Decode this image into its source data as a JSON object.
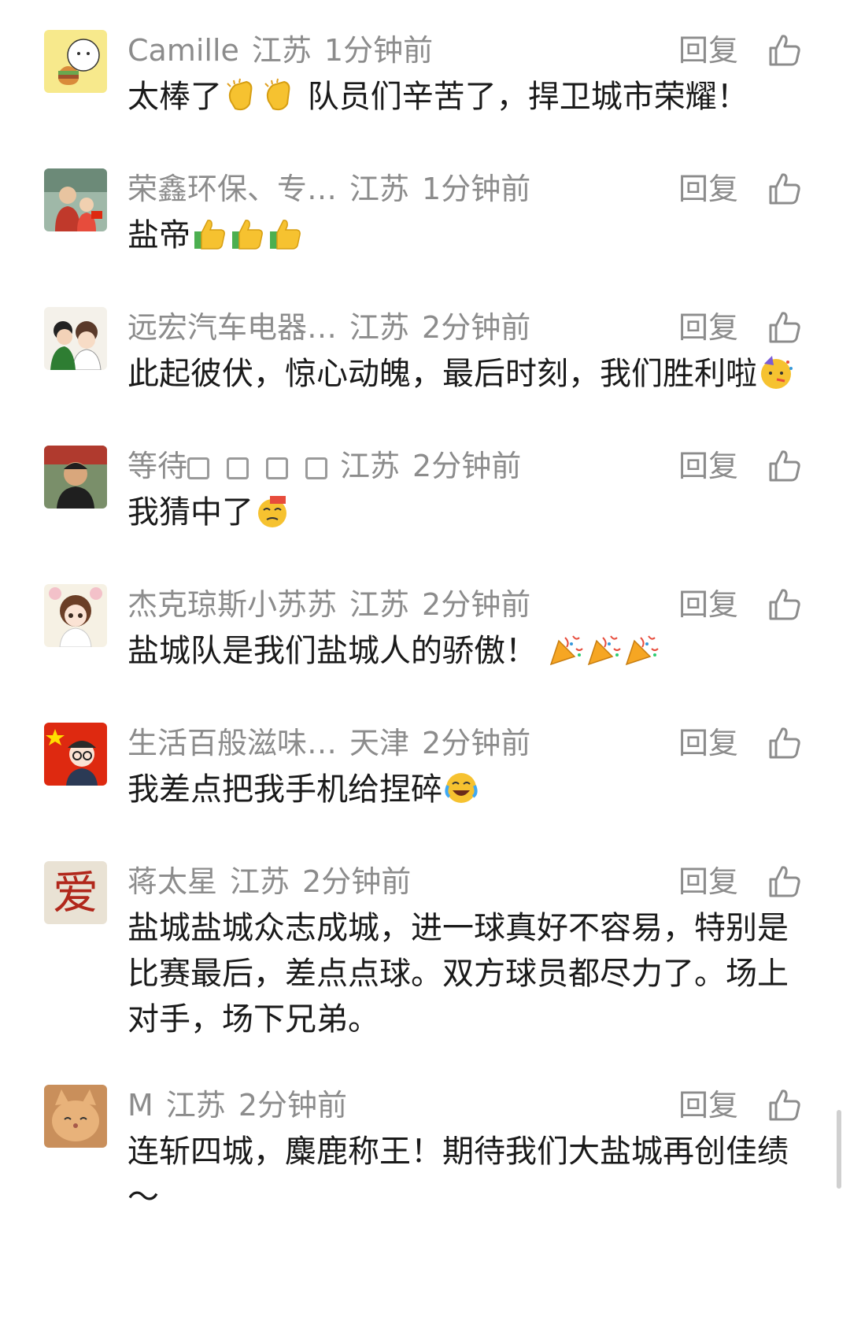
{
  "comments": [
    {
      "name": "Camille",
      "region": "江苏",
      "time": "1分钟前",
      "reply": "回复",
      "text": "太棒了",
      "text2": " 队员们辛苦了，捍卫城市荣耀！",
      "emoji": [
        "clap-icon",
        "clap-icon"
      ],
      "avatar": "burger-cartoon-avatar"
    },
    {
      "name": "荣鑫环保、专…",
      "region": "江苏",
      "time": "1分钟前",
      "reply": "回复",
      "text": "盐帝",
      "emoji": [
        "thumbs-up-icon",
        "thumbs-up-icon",
        "thumbs-up-icon"
      ],
      "avatar": "couple-photo-avatar"
    },
    {
      "name": "远宏汽车电器…",
      "region": "江苏",
      "time": "2分钟前",
      "reply": "回复",
      "text": "此起彼伏，惊心动魄，最后时刻，我们胜利啦",
      "emoji": [
        "party-face-icon"
      ],
      "avatar": "cartoon-couple-avatar"
    },
    {
      "name": "等待",
      "region": "江苏",
      "time": "2分钟前",
      "reply": "回复",
      "text": "我猜中了",
      "emoji": [
        "666-face-icon"
      ],
      "avatar": "man-photo-avatar"
    },
    {
      "name": "杰克琼斯小苏苏",
      "region": "江苏",
      "time": "2分钟前",
      "reply": "回复",
      "text": "盐城队是我们盐城人的骄傲！ ",
      "emoji": [
        "party-popper-icon",
        "party-popper-icon",
        "party-popper-icon"
      ],
      "avatar": "anime-girl-avatar"
    },
    {
      "name": "生活百般滋味…",
      "region": "天津",
      "time": "2分钟前",
      "reply": "回复",
      "text": "我差点把我手机给捏碎",
      "emoji": [
        "laugh-cry-icon"
      ],
      "avatar": "flag-glasses-avatar"
    },
    {
      "name": "蒋太星",
      "region": "江苏",
      "time": "2分钟前",
      "reply": "回复",
      "text": "盐城盐城众志成城，进一球真好不容易，特别是比赛最后，差点点球。双方球员都尽力了。场上对手，场下兄弟。",
      "emoji": [],
      "avatar": "ai-character-avatar",
      "avatar_text": "爱"
    },
    {
      "name": "M",
      "region": "江苏",
      "time": "2分钟前",
      "reply": "回复",
      "text": "连斩四城，麋鹿称王！期待我们大盐城再创佳绩～",
      "emoji": [],
      "avatar": "cat-photo-avatar"
    }
  ],
  "colors": {
    "meta": "#8c8c8c",
    "text": "#1a1a1a",
    "background": "#ffffff"
  }
}
